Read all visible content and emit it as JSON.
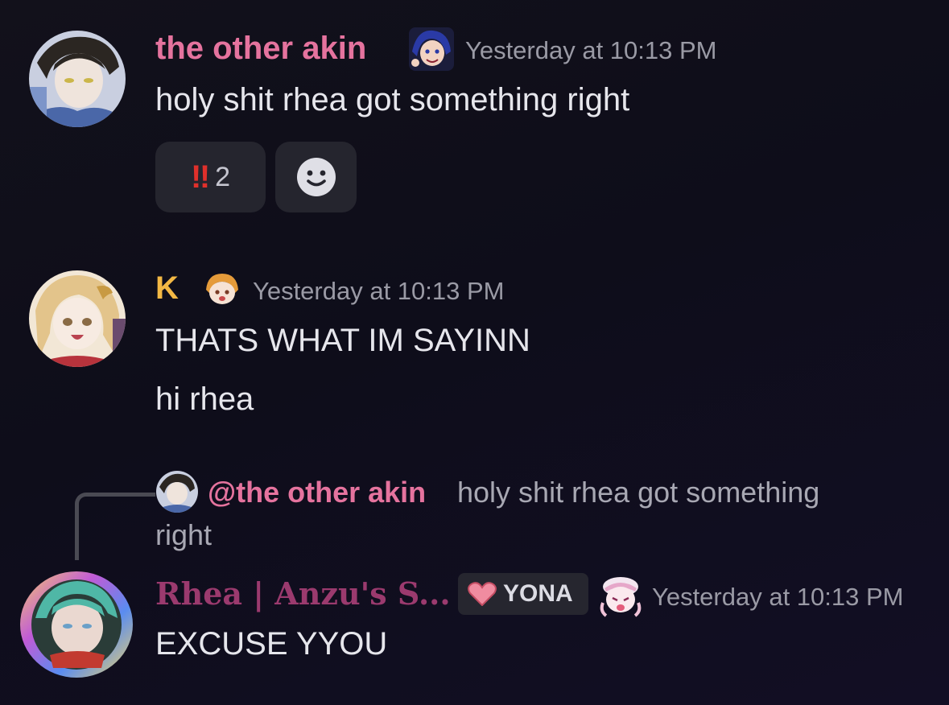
{
  "messages": [
    {
      "username": "the other akin",
      "username_color": "#e5739e",
      "timestamp": "Yesterday at 10:13 PM",
      "lines": [
        "holy shit rhea got something right"
      ],
      "reactions": [
        {
          "emoji": "‼",
          "count": "2"
        },
        {
          "emoji": "add-reaction"
        }
      ]
    },
    {
      "username": "K",
      "username_color": "#f3b844",
      "timestamp": "Yesterday at 10:13 PM",
      "lines": [
        "THATS WHAT IM  SAYINN",
        "hi rhea"
      ]
    },
    {
      "reply": {
        "mention": "@the other akin",
        "text_line1": "holy shit rhea got something",
        "text_line2": "right"
      },
      "username": "Rhea | Anzu's S...",
      "username_color": "#9b3a6e",
      "tag": "YONA",
      "timestamp": "Yesterday at 10:13 PM",
      "lines": [
        "EXCUSE YYOU"
      ]
    }
  ],
  "icons": {
    "reaction_double_exclamation": "double-exclamation-icon",
    "add_reaction": "smiley-icon",
    "tag_heart": "heart-icon"
  }
}
